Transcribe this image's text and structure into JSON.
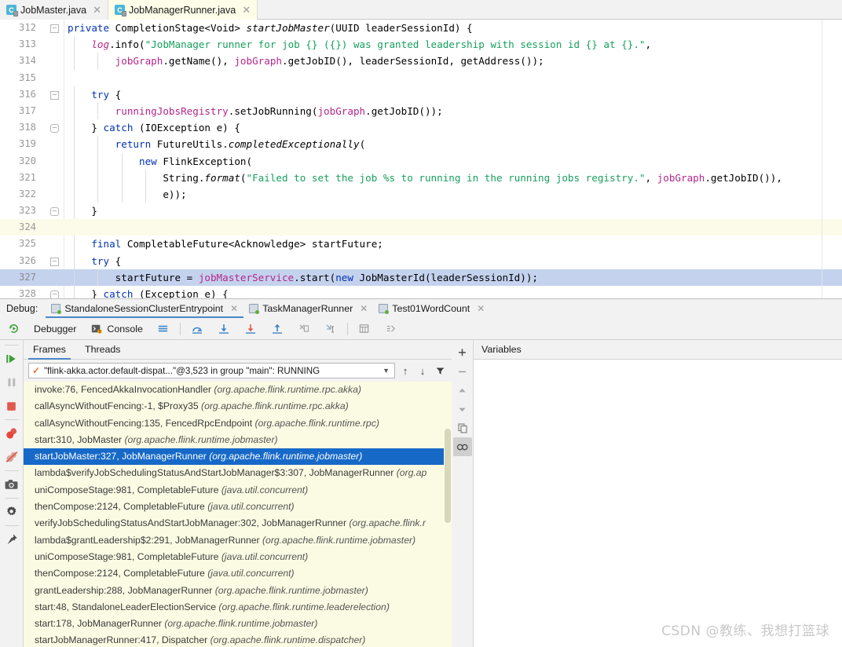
{
  "editor": {
    "tabs": [
      {
        "label": "JobMaster.java",
        "icon": "java-class-icon",
        "active": false
      },
      {
        "label": "JobManagerRunner.java",
        "icon": "java-class-icon",
        "active": true
      }
    ],
    "lines": [
      {
        "num": "312",
        "indent": 0,
        "fold": "open",
        "highlight": "none",
        "tokens": [
          {
            "t": "private ",
            "c": "kw"
          },
          {
            "t": "CompletionStage",
            "c": "pl"
          },
          {
            "t": "<",
            "c": "pl"
          },
          {
            "t": "Void",
            "c": "pl"
          },
          {
            "t": "> ",
            "c": "pl"
          },
          {
            "t": "startJobMaster",
            "c": "mi"
          },
          {
            "t": "(UUID leaderSessionId) {",
            "c": "pl"
          }
        ]
      },
      {
        "num": "313",
        "indent": 1,
        "fold": "none",
        "highlight": "none",
        "tokens": [
          {
            "t": "    ",
            "c": "pl"
          },
          {
            "t": "log",
            "c": "fldi"
          },
          {
            "t": ".info(",
            "c": "pl"
          },
          {
            "t": "\"JobManager runner for job {} ({}) was granted leadership with session id {} at {}.\"",
            "c": "str"
          },
          {
            "t": ",",
            "c": "pl"
          }
        ]
      },
      {
        "num": "314",
        "indent": 2,
        "fold": "none",
        "highlight": "none",
        "tokens": [
          {
            "t": "        ",
            "c": "pl"
          },
          {
            "t": "jobGraph",
            "c": "fld"
          },
          {
            "t": ".getName(), ",
            "c": "pl"
          },
          {
            "t": "jobGraph",
            "c": "fld"
          },
          {
            "t": ".getJobID(), leaderSessionId, getAddress());",
            "c": "pl"
          }
        ]
      },
      {
        "num": "315",
        "indent": 0,
        "fold": "none",
        "highlight": "none",
        "tokens": []
      },
      {
        "num": "316",
        "indent": 1,
        "fold": "open",
        "highlight": "none",
        "tokens": [
          {
            "t": "    ",
            "c": "pl"
          },
          {
            "t": "try",
            "c": "kw"
          },
          {
            "t": " {",
            "c": "pl"
          }
        ]
      },
      {
        "num": "317",
        "indent": 2,
        "fold": "none",
        "highlight": "none",
        "tokens": [
          {
            "t": "        ",
            "c": "pl"
          },
          {
            "t": "runningJobsRegistry",
            "c": "fld"
          },
          {
            "t": ".setJobRunning(",
            "c": "pl"
          },
          {
            "t": "jobGraph",
            "c": "fld"
          },
          {
            "t": ".getJobID());",
            "c": "pl"
          }
        ]
      },
      {
        "num": "318",
        "indent": 1,
        "fold": "close",
        "highlight": "none",
        "tokens": [
          {
            "t": "    } ",
            "c": "pl"
          },
          {
            "t": "catch",
            "c": "kw"
          },
          {
            "t": " (IOException e) {",
            "c": "pl"
          }
        ]
      },
      {
        "num": "319",
        "indent": 2,
        "fold": "none",
        "highlight": "none",
        "tokens": [
          {
            "t": "        ",
            "c": "pl"
          },
          {
            "t": "return",
            "c": "kw"
          },
          {
            "t": " FutureUtils.",
            "c": "pl"
          },
          {
            "t": "completedExceptionally",
            "c": "mi"
          },
          {
            "t": "(",
            "c": "pl"
          }
        ]
      },
      {
        "num": "320",
        "indent": 3,
        "fold": "none",
        "highlight": "none",
        "tokens": [
          {
            "t": "            ",
            "c": "pl"
          },
          {
            "t": "new",
            "c": "kw"
          },
          {
            "t": " FlinkException(",
            "c": "pl"
          }
        ]
      },
      {
        "num": "321",
        "indent": 4,
        "fold": "none",
        "highlight": "none",
        "tokens": [
          {
            "t": "                ",
            "c": "pl"
          },
          {
            "t": "String.",
            "c": "pl"
          },
          {
            "t": "format",
            "c": "mi"
          },
          {
            "t": "(",
            "c": "pl"
          },
          {
            "t": "\"Failed to set the job %s to running in the running jobs registry.\"",
            "c": "str"
          },
          {
            "t": ", ",
            "c": "pl"
          },
          {
            "t": "jobGraph",
            "c": "fld"
          },
          {
            "t": ".getJobID()),",
            "c": "pl"
          }
        ]
      },
      {
        "num": "322",
        "indent": 4,
        "fold": "none",
        "highlight": "none",
        "tokens": [
          {
            "t": "                e));",
            "c": "pl"
          }
        ]
      },
      {
        "num": "323",
        "indent": 1,
        "fold": "close",
        "highlight": "none",
        "tokens": [
          {
            "t": "    }",
            "c": "pl"
          }
        ]
      },
      {
        "num": "324",
        "indent": 0,
        "fold": "none",
        "highlight": "yellow",
        "tokens": []
      },
      {
        "num": "325",
        "indent": 1,
        "fold": "none",
        "highlight": "none",
        "tokens": [
          {
            "t": "    ",
            "c": "pl"
          },
          {
            "t": "final",
            "c": "kw"
          },
          {
            "t": " CompletableFuture<Acknowledge> startFuture;",
            "c": "pl"
          }
        ]
      },
      {
        "num": "326",
        "indent": 1,
        "fold": "open",
        "highlight": "none",
        "tokens": [
          {
            "t": "    ",
            "c": "pl"
          },
          {
            "t": "try",
            "c": "kw"
          },
          {
            "t": " {",
            "c": "pl"
          }
        ]
      },
      {
        "num": "327",
        "indent": 2,
        "fold": "none",
        "highlight": "blue",
        "tokens": [
          {
            "t": "        startFuture = ",
            "c": "pl"
          },
          {
            "t": "jobMasterService",
            "c": "fld"
          },
          {
            "t": ".start(",
            "c": "pl"
          },
          {
            "t": "new",
            "c": "kw"
          },
          {
            "t": " JobMasterId(leaderSessionId));",
            "c": "pl"
          }
        ]
      },
      {
        "num": "328",
        "indent": 1,
        "fold": "close",
        "highlight": "none",
        "tokens": [
          {
            "t": "    } ",
            "c": "pl"
          },
          {
            "t": "catch",
            "c": "kw"
          },
          {
            "t": " (Exception e) {",
            "c": "pl"
          }
        ]
      }
    ]
  },
  "debug": {
    "label": "Debug:",
    "run_tabs": [
      {
        "label": "StandaloneSessionClusterEntrypoint",
        "active": true
      },
      {
        "label": "TaskManagerRunner",
        "active": false
      },
      {
        "label": "Test01WordCount",
        "active": false
      }
    ],
    "toolbar": {
      "rerun_icon": "rerun-icon",
      "debugger_label": "Debugger",
      "console_label": "Console",
      "layout_icon": "layout-icon",
      "step_over_icon": "step-over-icon",
      "step_into_icon": "step-into-icon",
      "force_step_into_icon": "force-step-into-icon",
      "step_out_icon": "step-out-icon",
      "drop_frame_icon": "drop-frame-icon",
      "run_to_cursor_icon": "run-to-cursor-icon",
      "evaluate_icon": "evaluate-expression-icon",
      "mute_icon": "mute-breakpoints-icon"
    },
    "left_rail": [
      {
        "icon": "resume-program-icon"
      },
      {
        "icon": "pause-program-icon"
      },
      {
        "icon": "stop-icon"
      },
      {
        "icon": "view-breakpoints-icon"
      },
      {
        "icon": "mute-breakpoints-icon"
      },
      {
        "icon": "camera-icon"
      },
      {
        "icon": "settings-gear-icon"
      },
      {
        "icon": "pin-icon"
      }
    ],
    "sub_tabs": [
      {
        "label": "Frames",
        "active": true
      },
      {
        "label": "Threads",
        "active": false
      }
    ],
    "thread_selector": {
      "value": "\"flink-akka.actor.default-dispat...\"@3,523 in group \"main\": RUNNING",
      "status_icon": "running-check-icon",
      "caret_icon": "chevron-down-icon",
      "up_icon": "arrow-up-icon",
      "down_icon": "arrow-down-icon",
      "filter_icon": "filter-icon"
    },
    "frames": [
      {
        "method": "invoke:76, FencedAkkaInvocationHandler ",
        "pkg": "(org.apache.flink.runtime.rpc.akka)",
        "selected": false
      },
      {
        "method": "callAsyncWithoutFencing:-1, $Proxy35 ",
        "pkg": "(org.apache.flink.runtime.rpc.akka)",
        "selected": false
      },
      {
        "method": "callAsyncWithoutFencing:135, FencedRpcEndpoint ",
        "pkg": "(org.apache.flink.runtime.rpc)",
        "selected": false
      },
      {
        "method": "start:310, JobMaster ",
        "pkg": "(org.apache.flink.runtime.jobmaster)",
        "selected": false
      },
      {
        "method": "startJobMaster:327, JobManagerRunner ",
        "pkg": "(org.apache.flink.runtime.jobmaster)",
        "selected": true
      },
      {
        "method": "lambda$verifyJobSchedulingStatusAndStartJobManager$3:307, JobManagerRunner ",
        "pkg": "(org.ap",
        "selected": false
      },
      {
        "method": "uniComposeStage:981, CompletableFuture ",
        "pkg": "(java.util.concurrent)",
        "selected": false
      },
      {
        "method": "thenCompose:2124, CompletableFuture ",
        "pkg": "(java.util.concurrent)",
        "selected": false
      },
      {
        "method": "verifyJobSchedulingStatusAndStartJobManager:302, JobManagerRunner ",
        "pkg": "(org.apache.flink.r",
        "selected": false
      },
      {
        "method": "lambda$grantLeadership$2:291, JobManagerRunner ",
        "pkg": "(org.apache.flink.runtime.jobmaster)",
        "selected": false
      },
      {
        "method": "uniComposeStage:981, CompletableFuture ",
        "pkg": "(java.util.concurrent)",
        "selected": false
      },
      {
        "method": "thenCompose:2124, CompletableFuture ",
        "pkg": "(java.util.concurrent)",
        "selected": false
      },
      {
        "method": "grantLeadership:288, JobManagerRunner ",
        "pkg": "(org.apache.flink.runtime.jobmaster)",
        "selected": false
      },
      {
        "method": "start:48, StandaloneLeaderElectionService ",
        "pkg": "(org.apache.flink.runtime.leaderelection)",
        "selected": false
      },
      {
        "method": "start:178, JobManagerRunner ",
        "pkg": "(org.apache.flink.runtime.jobmaster)",
        "selected": false
      },
      {
        "method": "startJobManagerRunner:417, Dispatcher ",
        "pkg": "(org.apache.flink.runtime.dispatcher)",
        "selected": false
      }
    ],
    "vert_rail": [
      {
        "icon": "plus-icon",
        "pressed": false
      },
      {
        "icon": "minus-icon",
        "pressed": false
      },
      {
        "icon": "triangle-up-icon",
        "pressed": false
      },
      {
        "icon": "triangle-down-icon",
        "pressed": false
      },
      {
        "icon": "copy-icon",
        "pressed": false
      },
      {
        "icon": "watches-icon",
        "pressed": true
      }
    ],
    "variables": {
      "title": "Variables"
    }
  },
  "watermark": "CSDN @教练、我想打篮球",
  "colors": {
    "accent_blue": "#1769c8",
    "tab_active_bg": "#fdfde8",
    "frames_bg": "#fbfbe4",
    "caret_row": "#c4d2ee",
    "modified_row": "#fcfbe9"
  }
}
